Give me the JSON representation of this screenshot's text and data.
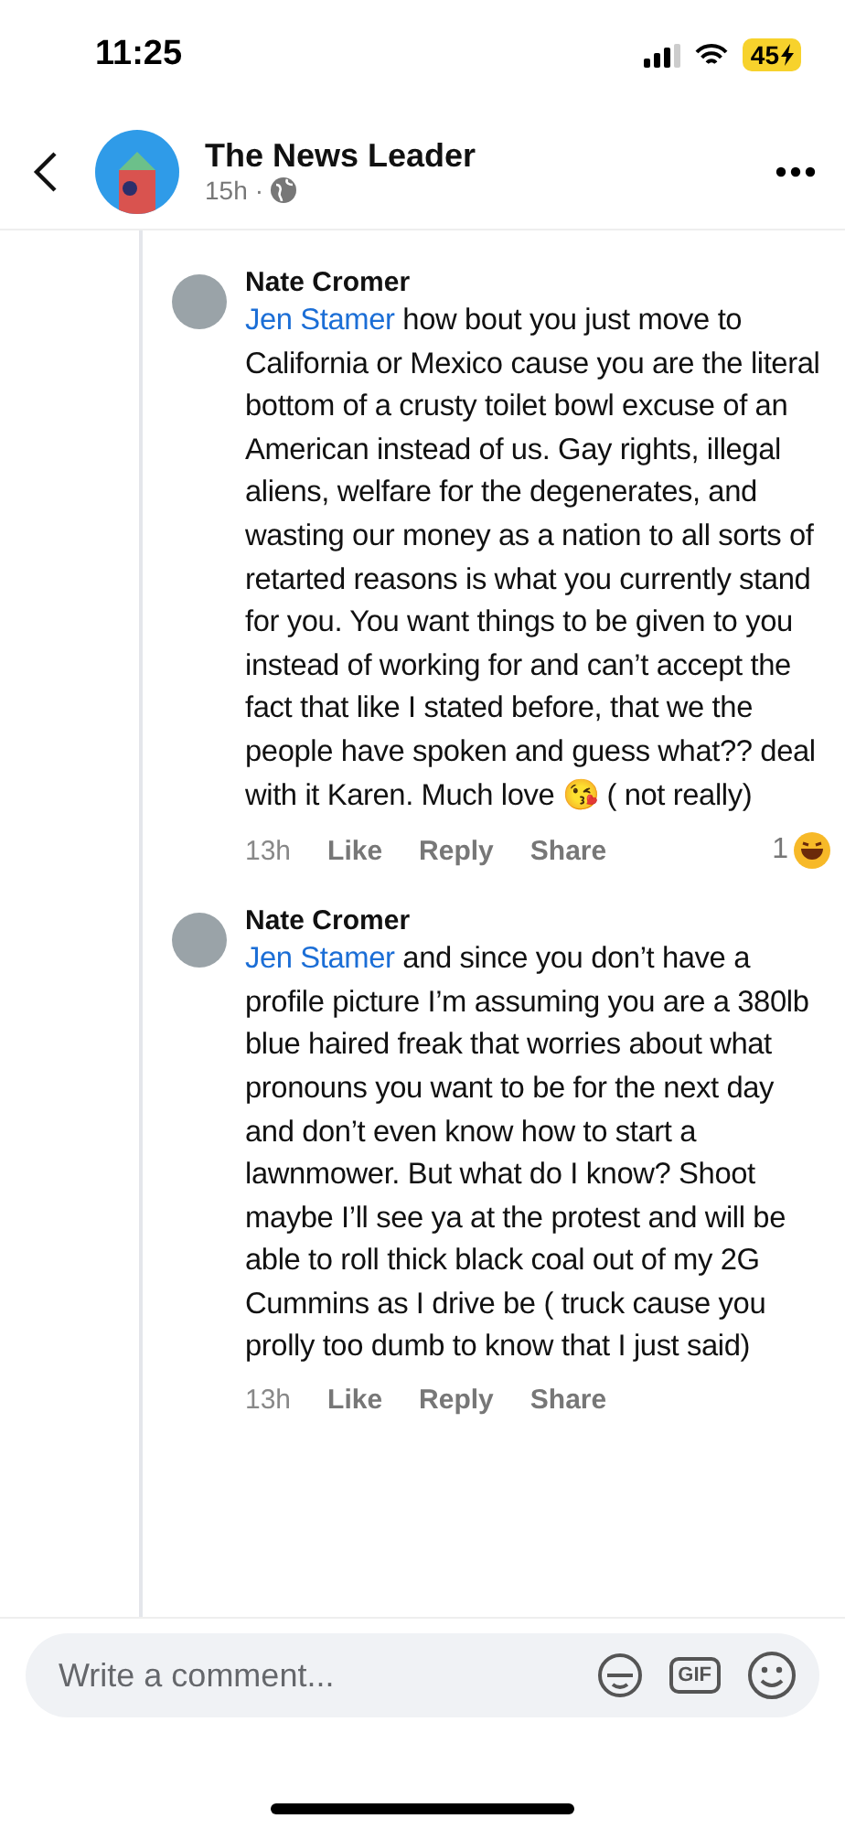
{
  "status_bar": {
    "time": "11:25",
    "battery": "45"
  },
  "header": {
    "title": "The News Leader",
    "age": "15h",
    "separator": "·"
  },
  "comments": [
    {
      "author": "Nate Cromer",
      "mention": "Jen Stamer",
      "text": "how bout you just move to California or Mexico cause you are the literal bottom of a crusty toilet bowl excuse of an American instead of us. Gay rights, illegal aliens, welfare for the degenerates, and wasting our money as a nation to all sorts of retarted reasons is what you currently stand for you. You want things to be given to you instead of working for and can’t accept the fact that like I stated before, that we the people have spoken and guess what?? deal with it Karen. Much love 😘 ( not really)",
      "age": "13h",
      "actions": [
        "Like",
        "Reply",
        "Share"
      ],
      "reaction_count": "1"
    },
    {
      "author": "Nate Cromer",
      "mention": "Jen Stamer",
      "text": "and since you don’t have a profile picture I’m assuming you are a 380lb blue haired freak that worries about what pronouns you want to be for the next day and don’t even know how to start a lawnmower. But what do I know? Shoot maybe I’ll see ya at the protest and will be able to roll thick black coal out of my 2G Cummins as I drive be ( truck cause you prolly too dumb to know that I just said)",
      "age": "13h",
      "actions": [
        "Like",
        "Reply",
        "Share"
      ]
    }
  ],
  "composer": {
    "placeholder": "Write a comment...",
    "gif_label": "GIF"
  }
}
